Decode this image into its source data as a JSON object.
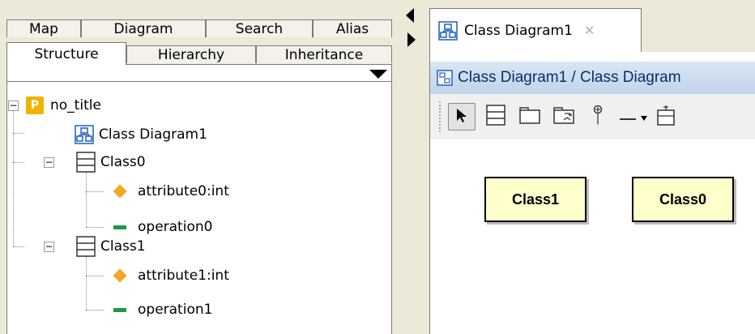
{
  "left_panel": {
    "back_tabs": [
      "Map",
      "Diagram",
      "Search",
      "Alias"
    ],
    "front_tabs": [
      "Structure",
      "Hierarchy",
      "Inheritance"
    ],
    "active_tab": "Structure",
    "tree": {
      "root": {
        "icon": "project-icon",
        "icon_letter": "P",
        "label": "no_title"
      },
      "items": [
        {
          "icon": "class-diagram-icon",
          "label": "Class Diagram1"
        },
        {
          "icon": "class-icon",
          "label": "Class0",
          "children": [
            {
              "icon": "attribute-icon",
              "label": "attribute0:int"
            },
            {
              "icon": "operation-icon",
              "label": "operation0"
            }
          ]
        },
        {
          "icon": "class-icon",
          "label": "Class1",
          "children": [
            {
              "icon": "attribute-icon",
              "label": "attribute1:int"
            },
            {
              "icon": "operation-icon",
              "label": "operation1"
            }
          ]
        }
      ]
    }
  },
  "editor": {
    "tab_label": "Class Diagram1",
    "tab_close_icon": "close-icon",
    "title_path": "Class Diagram1 / Class Diagram",
    "toolbar_icons": [
      "select-arrow-icon",
      "class-icon",
      "package-icon",
      "subsystem-icon",
      "interface-icon",
      "association-icon",
      "dropdown-arrow-icon",
      "note-icon"
    ],
    "canvas_classes": [
      "Class1",
      "Class0"
    ]
  },
  "colors": {
    "panel_bg": "#ece9d8",
    "class_fill": "#ffffcc",
    "attribute_icon": "#f5a623",
    "operation_icon": "#1a9a4a",
    "project_icon": "#f0b400",
    "diagram_icon": "#1f5fbf",
    "titlebar": "#c9daee"
  }
}
